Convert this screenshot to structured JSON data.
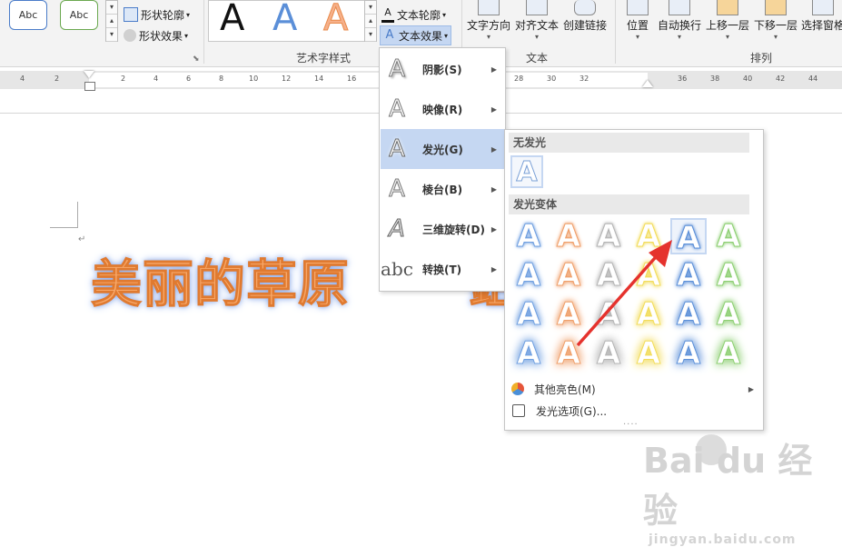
{
  "ribbon": {
    "style_samples": [
      "Abc",
      "Abc"
    ],
    "shape_commands": {
      "outline": "形状轮廓",
      "effect": "形状效果"
    },
    "wordart_gallery": [
      "A",
      "A",
      "A"
    ],
    "text_commands": {
      "outline": "文本轮廓",
      "effect": "文本效果"
    },
    "big_commands": [
      "文字方向",
      "对齐文本",
      "创建链接"
    ],
    "arrange_commands": [
      "位置",
      "自动换行",
      "上移一层",
      "下移一层",
      "选择窗格"
    ],
    "group_labels": {
      "wordart": "艺术字样式",
      "text": "文本",
      "arrange": "排列"
    }
  },
  "ruler": {
    "left_ticks": [
      "4",
      "2"
    ],
    "ticks": [
      "2",
      "4",
      "6",
      "8",
      "10",
      "12",
      "14",
      "16",
      "28",
      "30",
      "32",
      "36",
      "38",
      "40",
      "42",
      "44"
    ]
  },
  "document": {
    "text": "美丽的草原",
    "text_tail": "鉏",
    "para_mark": "↵"
  },
  "effects_menu": {
    "items": [
      {
        "label": "阴影(S)",
        "glyph": "A"
      },
      {
        "label": "映像(R)",
        "glyph": "A"
      },
      {
        "label": "发光(G)",
        "glyph": "A",
        "highlighted": true
      },
      {
        "label": "棱台(B)",
        "glyph": "A"
      },
      {
        "label": "三维旋转(D)",
        "glyph": "A"
      },
      {
        "label": "转换(T)",
        "glyph": "abc"
      }
    ]
  },
  "glow_submenu": {
    "no_glow_label": "无发光",
    "variants_label": "发光变体",
    "glyph": "A",
    "more_colors": "其他亮色(M)",
    "options": "发光选项(G)...",
    "grip": "....",
    "colors": [
      "#6f9fe0",
      "#ef9f6a",
      "#b4b4b4",
      "#f2dc5a",
      "#5b8fd8",
      "#8dcf72"
    ]
  },
  "watermark": {
    "logo": "Bai du 经验",
    "url": "jingyan.baidu.com"
  }
}
